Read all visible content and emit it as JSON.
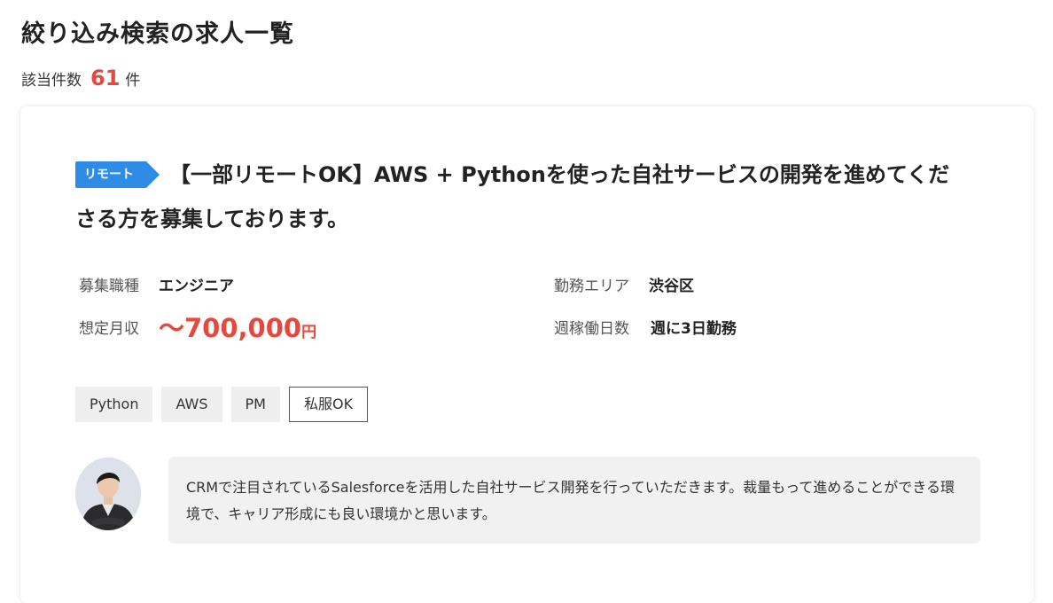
{
  "header": {
    "title": "絞り込み検索の求人一覧",
    "count_label": "該当件数",
    "count_value": "61",
    "count_unit": "件"
  },
  "job": {
    "badge": "リモート",
    "title": "【一部リモートOK】AWS + Pythonを使った自社サービスの開発を進めてくださる方を募集しております。",
    "specs": {
      "job_type_label": "募集職種",
      "job_type_value": "エンジニア",
      "area_label": "勤務エリア",
      "area_value": "渋谷区",
      "salary_label": "想定月収",
      "salary_value": "〜700,000",
      "salary_unit": "円",
      "days_label": "週稼働日数",
      "days_value": "週に3日勤務"
    },
    "tags": [
      "Python",
      "AWS",
      "PM",
      "私服OK"
    ],
    "comment": "CRMで注目されているSalesforceを活用した自社サービス開発を行っていただきます。裁量もって進めることができる環境で、キャリア形成にも良い環境かと思います。"
  },
  "colors": {
    "accent_red": "#e8473e",
    "badge_blue": "#2f8ce6",
    "tag_bg": "#eeeeee",
    "comment_bg": "#f1f1f1"
  }
}
